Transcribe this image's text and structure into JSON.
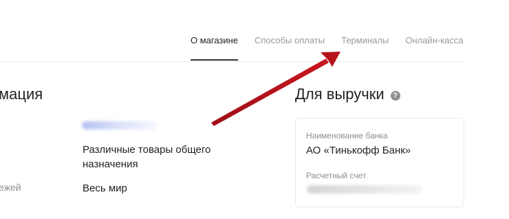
{
  "tabs": [
    {
      "label": "О магазине",
      "active": true
    },
    {
      "label": "Способы оплаты",
      "active": false
    },
    {
      "label": "Терминалы",
      "active": false
    },
    {
      "label": "Онлайн-касса",
      "active": false
    }
  ],
  "left_section": {
    "title": "мация",
    "field_label_partial": "ежей",
    "goods_value": "Различные товары общего назначения",
    "region_value": "Весь мир"
  },
  "right_section": {
    "title": "Для выручки",
    "help_icon": "question-circle-icon",
    "bank_label": "Наименование банка",
    "bank_value": "АО «Тинькофф Банк»",
    "account_label": "Расчетный счет"
  },
  "colors": {
    "arrow": "#b5121b",
    "active_tab_underline": "#333333",
    "inactive_tab": "#9a9a9a"
  }
}
